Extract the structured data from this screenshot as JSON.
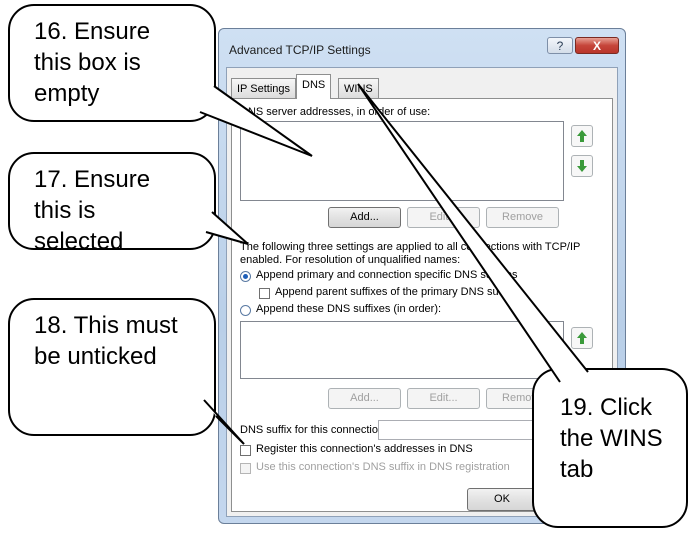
{
  "dialog": {
    "title": "Advanced TCP/IP Settings",
    "help_button": "?",
    "close_button": "X",
    "tabs": [
      {
        "label": "IP Settings",
        "active": false
      },
      {
        "label": "DNS",
        "active": true
      },
      {
        "label": "WINS",
        "active": false
      }
    ],
    "dns_servers_label": "DNS server addresses, in order of use:",
    "server_buttons": {
      "add": "Add...",
      "edit": "Edit...",
      "remove": "Remove"
    },
    "settings_note_line1": "The following three settings are applied to all connections with TCP/IP",
    "settings_note_line2": "enabled. For resolution of unqualified names:",
    "radio_primary": "Append primary and connection specific DNS suffixes",
    "check_parent": "Append parent suffixes of the primary DNS suffix",
    "radio_these": "Append these DNS suffixes (in order):",
    "suffix_buttons": {
      "add": "Add...",
      "edit": "Edit...",
      "remove": "Remove"
    },
    "dns_suffix_label": "DNS suffix for this connection:",
    "register_label": "Register this connection's addresses in DNS",
    "use_suffix_label": "Use this connection's DNS suffix in DNS registration",
    "ok_button": "OK"
  },
  "callouts": [
    {
      "text": "16. Ensure\nthis box is\nempty"
    },
    {
      "text": "17. Ensure\nthis is\nselected"
    },
    {
      "text": "18. This must\nbe unticked"
    },
    {
      "text": "19. Click\nthe WINS\ntab"
    }
  ]
}
